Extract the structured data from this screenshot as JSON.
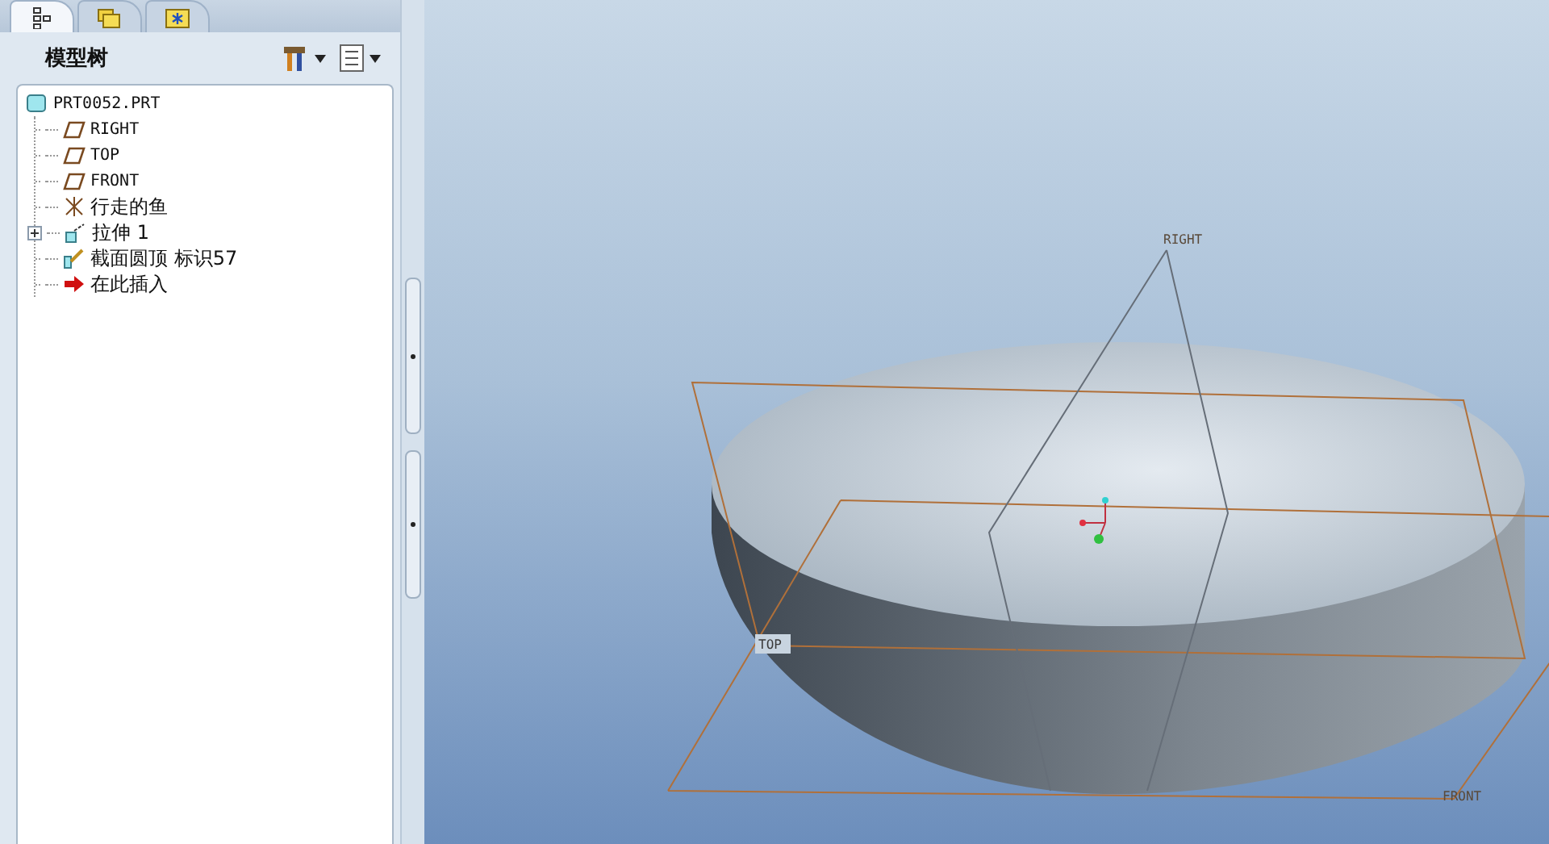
{
  "navigator": {
    "tabs": [
      {
        "kind": "tree",
        "selected": true
      },
      {
        "kind": "folders",
        "selected": false
      },
      {
        "kind": "favorites",
        "selected": false
      }
    ],
    "title": "模型树",
    "tree": {
      "label": "PRT0052.PRT",
      "kind": "part",
      "children": [
        {
          "label": "RIGHT",
          "kind": "plane",
          "collapsed": false
        },
        {
          "label": "TOP",
          "kind": "plane",
          "collapsed": false
        },
        {
          "label": "FRONT",
          "kind": "plane",
          "collapsed": false
        },
        {
          "label": "行走的鱼",
          "kind": "csys",
          "collapsed": false
        },
        {
          "label": "拉伸 1",
          "kind": "extrude",
          "collapsed": true
        },
        {
          "label": "截面圆顶 标识57",
          "kind": "dome",
          "collapsed": false
        },
        {
          "label": "在此插入",
          "kind": "insert",
          "collapsed": false
        }
      ]
    }
  },
  "viewport": {
    "plane_labels": [
      {
        "text": "RIGHT",
        "kind": "right"
      },
      {
        "text": "TOP",
        "kind": "top"
      },
      {
        "text": "FRONT",
        "kind": "front"
      }
    ]
  }
}
